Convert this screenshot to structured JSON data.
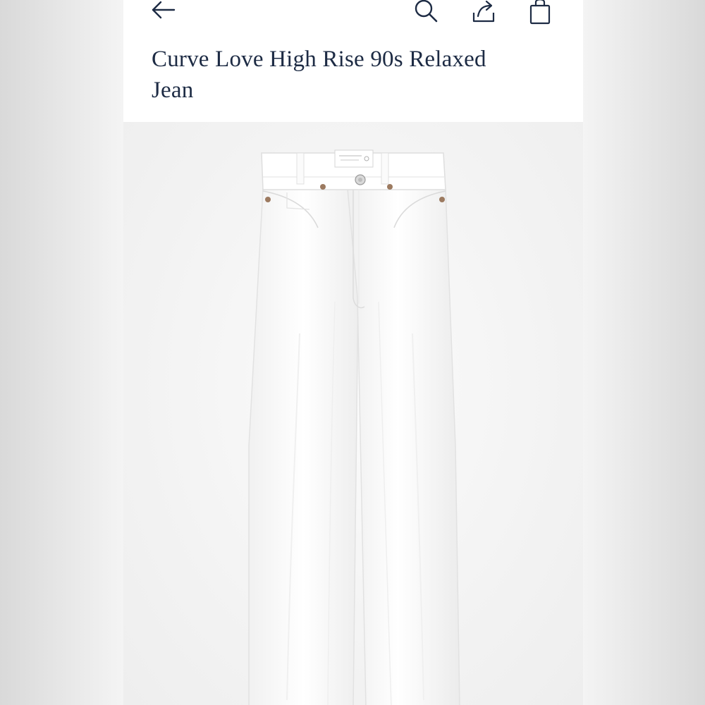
{
  "header": {
    "icons": {
      "back": "arrow-left-icon",
      "search": "search-icon",
      "share": "share-icon",
      "bag": "shopping-bag-icon"
    }
  },
  "product": {
    "title": "Curve Love High Rise 90s Relaxed Jean",
    "image": {
      "subject": "white-jeans",
      "color": "#ffffff"
    }
  },
  "colors": {
    "title_text": "#1d2b44",
    "icon_stroke": "#1d2b44",
    "image_background": "#f3f3f3"
  }
}
